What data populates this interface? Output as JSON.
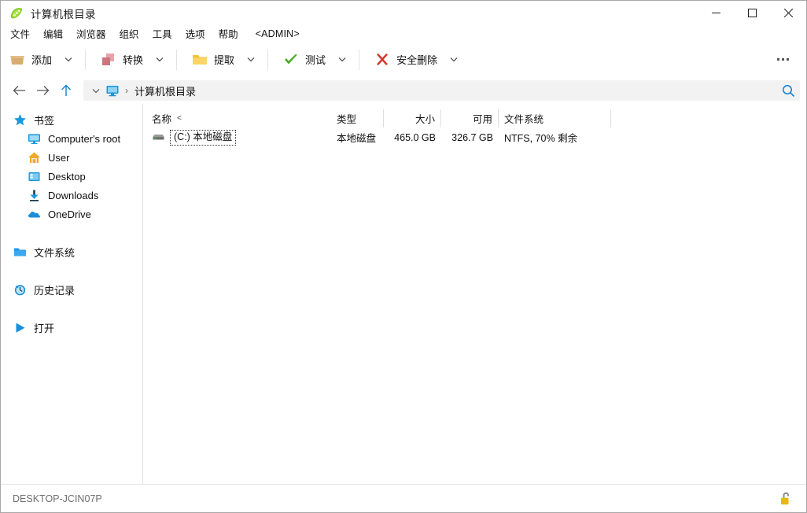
{
  "window": {
    "title": "计算机根目录",
    "app_icon": "peapod-icon",
    "controls": {
      "minimize": "minimize-icon",
      "maximize": "maximize-icon",
      "close": "close-icon"
    }
  },
  "menubar": {
    "items": [
      {
        "label": "文件"
      },
      {
        "label": "编辑"
      },
      {
        "label": "浏览器"
      },
      {
        "label": "组织"
      },
      {
        "label": "工具"
      },
      {
        "label": "选项"
      },
      {
        "label": "帮助"
      },
      {
        "label": "<ADMIN>"
      }
    ]
  },
  "toolbar": {
    "buttons": [
      {
        "label": "添加",
        "icon": "box-icon",
        "has_dropdown": true
      },
      {
        "label": "转换",
        "icon": "convert-squares-icon",
        "has_dropdown": true
      },
      {
        "label": "提取",
        "icon": "folder-icon",
        "has_dropdown": true
      },
      {
        "label": "测试",
        "icon": "check-icon",
        "has_dropdown": true
      },
      {
        "label": "安全删除",
        "icon": "red-x-icon",
        "has_dropdown": true
      }
    ],
    "overflow": "more-options-icon"
  },
  "addressbar": {
    "back": "back-arrow-icon",
    "forward": "forward-arrow-icon",
    "up": "up-arrow-icon",
    "history_chevron": "chevron-down-icon",
    "crumb_icon": "monitor-icon",
    "crumb_separator": "›",
    "path": "计算机根目录",
    "search": "search-icon"
  },
  "sidebar": {
    "sections": [
      {
        "label": "书签",
        "icon": "star-icon",
        "children": [
          {
            "label": "Computer's root",
            "icon": "monitor-icon"
          },
          {
            "label": "User",
            "icon": "home-icon"
          },
          {
            "label": "Desktop",
            "icon": "desktop-icon"
          },
          {
            "label": "Downloads",
            "icon": "download-icon"
          },
          {
            "label": "OneDrive",
            "icon": "cloud-icon"
          }
        ]
      },
      {
        "label": "文件系统",
        "icon": "folder-blue-icon",
        "children": []
      },
      {
        "label": "历史记录",
        "icon": "history-clock-icon",
        "children": []
      },
      {
        "label": "打开",
        "icon": "play-triangle-icon",
        "children": []
      }
    ]
  },
  "filelist": {
    "columns": [
      {
        "key": "name",
        "label": "名称",
        "sort": "<"
      },
      {
        "key": "type",
        "label": "类型"
      },
      {
        "key": "size",
        "label": "大小"
      },
      {
        "key": "free",
        "label": "可用"
      },
      {
        "key": "fs",
        "label": "文件系统"
      }
    ],
    "rows": [
      {
        "icon": "harddisk-icon",
        "name": "(C:) 本地磁盘",
        "type": "本地磁盘",
        "size": "465.0 GB",
        "free": "326.7 GB",
        "fs": "NTFS, 70% 剩余",
        "focused": true
      }
    ]
  },
  "statusbar": {
    "text": "DESKTOP-JCIN07P",
    "lock_icon": "unlocked-padlock-icon"
  },
  "colors": {
    "accent": "#0078d7",
    "toolbar_box": "#d9b073",
    "convert_pink": "#c9767e",
    "folder_yellow": "#f5c242",
    "check_green": "#4caf28",
    "x_red": "#d33a2c",
    "lock_yellow": "#e8b710"
  }
}
